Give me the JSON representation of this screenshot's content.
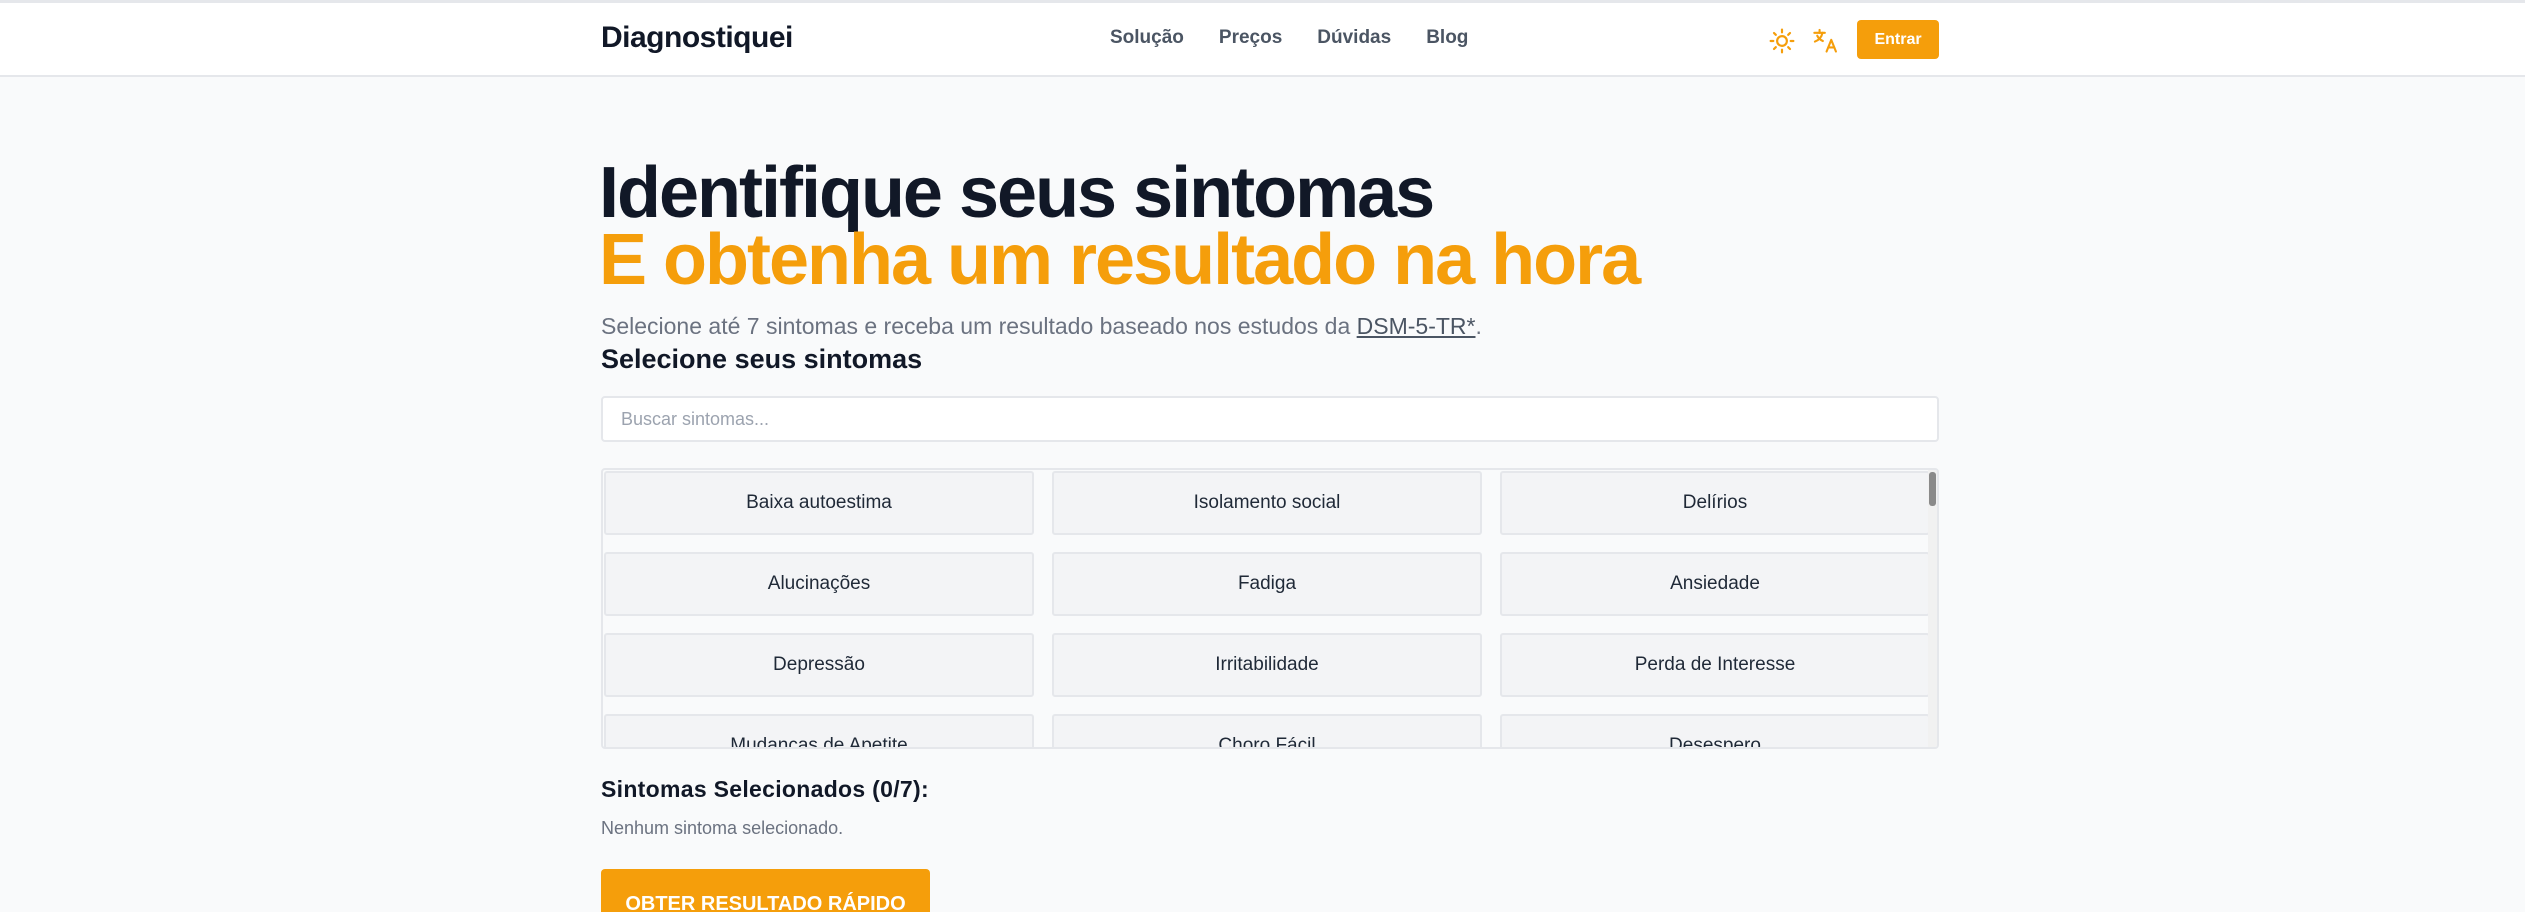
{
  "header": {
    "logo_text": "Diagnostiquei",
    "nav": [
      "Solução",
      "Preços",
      "Dúvidas",
      "Blog"
    ],
    "theme_icon": "sun-icon",
    "language_icon": "translate-icon",
    "login_label": "Entrar"
  },
  "hero": {
    "title": "Identifique seus sintomas",
    "title_highlight": "E obtenha um resultado na hora",
    "subtitle_prefix": "Selecione até 7 sintomas e receba um resultado baseado nos estudos da ",
    "subtitle_link": "DSM-5-TR*",
    "subtitle_suffix": "."
  },
  "symptoms": {
    "section_title": "Selecione seus sintomas",
    "search_placeholder": "Buscar sintomas...",
    "items": [
      "Baixa autoestima",
      "Isolamento social",
      "Delírios",
      "Alucinações",
      "Fadiga",
      "Ansiedade",
      "Depressão",
      "Irritabilidade",
      "Perda de Interesse",
      "Mudanças de Apetite",
      "Choro Fácil",
      "Desespero"
    ]
  },
  "selected": {
    "title": "Sintomas Selecionados (0/7):",
    "empty_text": "Nenhum sintoma selecionado."
  },
  "cta_label": "OBTER RESULTADO RÁPIDO",
  "colors": {
    "accent": "#f59e0b",
    "text_dark": "#111827",
    "background": "#f9fafb"
  }
}
